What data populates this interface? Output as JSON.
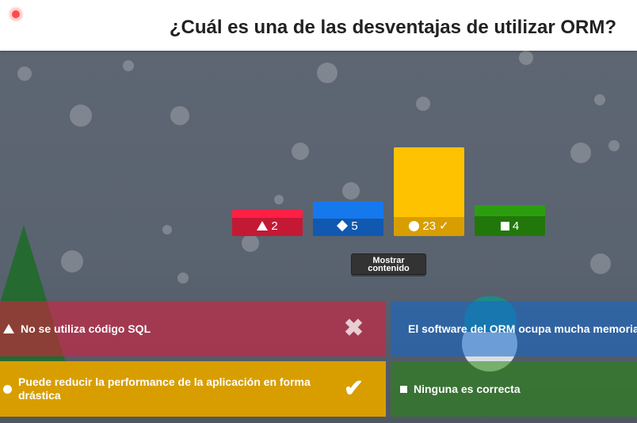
{
  "header": {
    "question": "¿Cuál es una de las desventajas de utilizar ORM?",
    "recording_indicator": "record-dot-icon"
  },
  "results": {
    "bars": [
      {
        "shape": "triangle-icon",
        "count": "2",
        "color": "#e21b3c",
        "correct": false
      },
      {
        "shape": "diamond-icon",
        "count": "5",
        "color": "#1368ce",
        "correct": false
      },
      {
        "shape": "circle-icon",
        "count": "23",
        "color": "#d89e00",
        "correct": true,
        "check": "✓"
      },
      {
        "shape": "square-icon",
        "count": "4",
        "color": "#26890c",
        "correct": false
      }
    ],
    "show_content_label": "Mostrar contenido"
  },
  "answers": [
    {
      "shape": "triangle-icon",
      "text": "No se utiliza código SQL",
      "result": "incorrect",
      "mark": "✖"
    },
    {
      "shape": "diamond-icon",
      "text": "El software del ORM ocupa mucha memoria",
      "result": "incorrect",
      "mark": ""
    },
    {
      "shape": "circle-icon",
      "text": "Puede reducir la performance de la aplicación en forma drástica",
      "result": "correct",
      "mark": "✔"
    },
    {
      "shape": "square-icon",
      "text": "Ninguna es correcta",
      "result": "incorrect",
      "mark": ""
    }
  ],
  "colors": {
    "red": "#e21b3c",
    "blue": "#1368ce",
    "yellow": "#d89e00",
    "green": "#26890c"
  }
}
